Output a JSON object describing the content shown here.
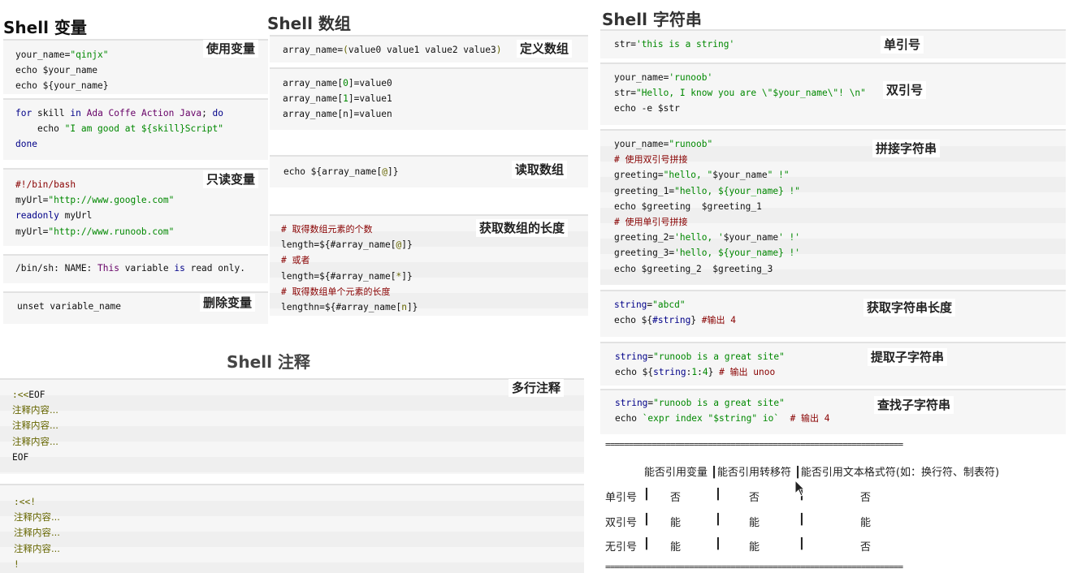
{
  "titles": {
    "variables": "Shell 变量",
    "arrays": "Shell 数组",
    "strings": "Shell 字符串",
    "comments": "Shell 注释"
  },
  "labels": {
    "use_var": "使用变量",
    "readonly_var": "只读变量",
    "delete_var": "删除变量",
    "define_array": "定义数组",
    "read_array": "读取数组",
    "array_len": "获取数组的长度",
    "multi_comment": "多行注释",
    "single_quote": "单引号",
    "double_quote": "双引号",
    "concat": "拼接字符串",
    "str_len": "获取字符串长度",
    "substr": "提取子字符串",
    "find_substr": "查找子字符串"
  },
  "code": {
    "var1": [
      "your_name=\"qinjx\"",
      "echo $your_name",
      "echo ${your_name}"
    ],
    "var2": [
      "for skill in Ada Coffe Action Java; do",
      "    echo \"I am good at ${skill}Script\"",
      "done"
    ],
    "var3": [
      "#!/bin/bash",
      "myUrl=\"http://www.google.com\"",
      "readonly myUrl",
      "myUrl=\"http://www.runoob.com\""
    ],
    "var4": [
      "/bin/sh: NAME: This variable is read only."
    ],
    "var5": [
      "unset variable_name"
    ],
    "arr1": [
      "array_name=(value0 value1 value2 value3)"
    ],
    "arr2": [
      "array_name[0]=value0",
      "array_name[1]=value1",
      "array_name[n]=valuen"
    ],
    "arr3": [
      "echo ${array_name[@]}"
    ],
    "arr4": [
      "# 取得数组元素的个数",
      "length=${#array_name[@]}",
      "# 或者",
      "length=${#array_name[*]}",
      "# 取得数组单个元素的长度",
      "lengthn=${#array_name[n]}"
    ],
    "cm1": [
      ":<<EOF",
      "注释内容...",
      "注释内容...",
      "注释内容...",
      "EOF"
    ],
    "cm2": [
      ":<<!",
      "注释内容...",
      "注释内容...",
      "注释内容...",
      "!"
    ],
    "str1": [
      "str='this is a string'"
    ],
    "str2": [
      "your_name='runoob'",
      "str=\"Hello, I know you are \\\"$your_name\\\"! \\n\"",
      "echo -e $str"
    ],
    "str3": [
      "your_name=\"runoob\"",
      "# 使用双引号拼接",
      "greeting=\"hello, \"$your_name\" !\"",
      "greeting_1=\"hello, ${your_name} !\"",
      "echo $greeting  $greeting_1",
      "# 使用单引号拼接",
      "greeting_2='hello, '$your_name' !'",
      "greeting_3='hello, ${your_name} !'",
      "echo $greeting_2  $greeting_3"
    ],
    "str4": [
      "string=\"abcd\"",
      "echo ${#string} #输出 4"
    ],
    "str5": [
      "string=\"runoob is a great site\"",
      "echo ${string:1:4} # 输出 unoo"
    ],
    "str6": [
      "string=\"runoob is a great site\"",
      "echo `expr index \"$string\" io`  # 输出 4"
    ]
  },
  "table": {
    "rule": "================================================================",
    "header": "能否引用变量 ┃能否引用转移符 ┃能否引用文本格式符(如：换行符、制表符)",
    "rows": [
      {
        "name": "单引号",
        "sep": "┃",
        "var": "否",
        "esc": "否",
        "fmt": "否"
      },
      {
        "name": "双引号",
        "sep": "┃",
        "var": "能",
        "esc": "能",
        "fmt": "能"
      },
      {
        "name": "无引号",
        "sep": "┃",
        "var": "能",
        "esc": "能",
        "fmt": "否"
      }
    ]
  }
}
